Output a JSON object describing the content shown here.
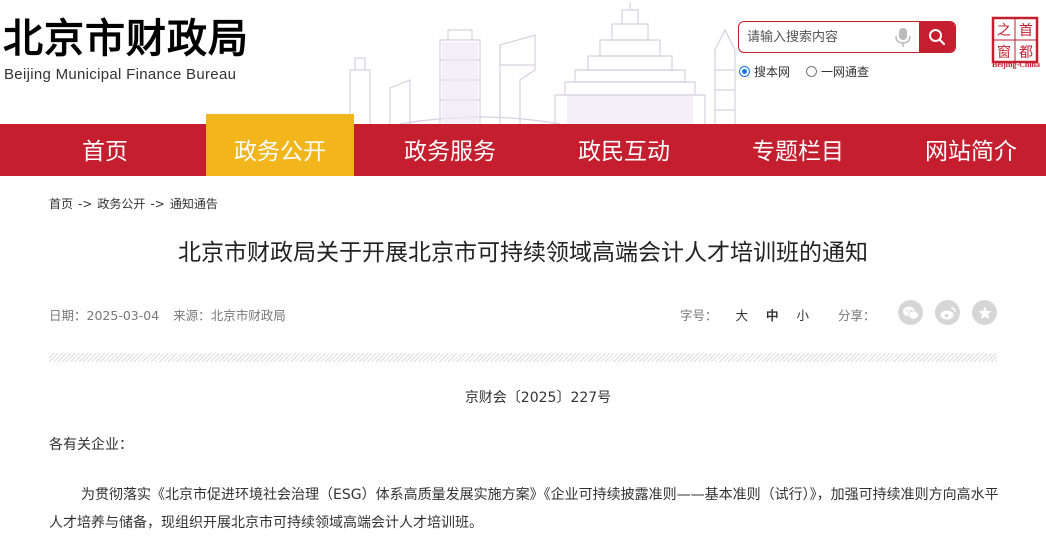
{
  "header": {
    "title": "北京市财政局",
    "subtitle": "Beijing Municipal Finance Bureau",
    "seal_chars": [
      "首",
      "都",
      "之",
      "窗"
    ],
    "seal_caption": "Beijing-China"
  },
  "search": {
    "placeholder": "请输入搜索内容",
    "icon": "search-icon",
    "mic_icon": "microphone-icon",
    "scope_options": [
      {
        "label": "搜本网",
        "checked": true
      },
      {
        "label": "一网通查",
        "checked": false
      }
    ]
  },
  "nav": {
    "items": [
      "首页",
      "政务公开",
      "政务服务",
      "政民互动",
      "专题栏目",
      "网站简介"
    ],
    "active_index": 1
  },
  "breadcrumb": {
    "items": [
      "首页",
      "政务公开",
      "通知通告"
    ],
    "separator": "->"
  },
  "article": {
    "title": "北京市财政局关于开展北京市可持续领域高端会计人才培训班的通知",
    "date_label": "日期：",
    "date": "2025-03-04",
    "source_label": "来源：",
    "source": "北京市财政局",
    "font_size_label": "字号：",
    "font_sizes": [
      "大",
      "中",
      "小"
    ],
    "share_label": "分享：",
    "share_icons": [
      "wechat-icon",
      "weibo-icon",
      "favorite-star-icon"
    ],
    "doc_number": "京财会〔2025〕227号",
    "salutation": "各有关企业：",
    "paragraph1": "为贯彻落实《北京市促进环境社会治理（ESG）体系高质量发展实施方案》《企业可持续披露准则——基本准则（试行）》，加强可持续准则方向高水平人才培养与储备，现组织开展北京市可持续领域高端会计人才培训班。"
  },
  "colors": {
    "brand_red": "#c41e2f",
    "active_tab": "#f2b51c",
    "radio_blue": "#1a73e8"
  }
}
